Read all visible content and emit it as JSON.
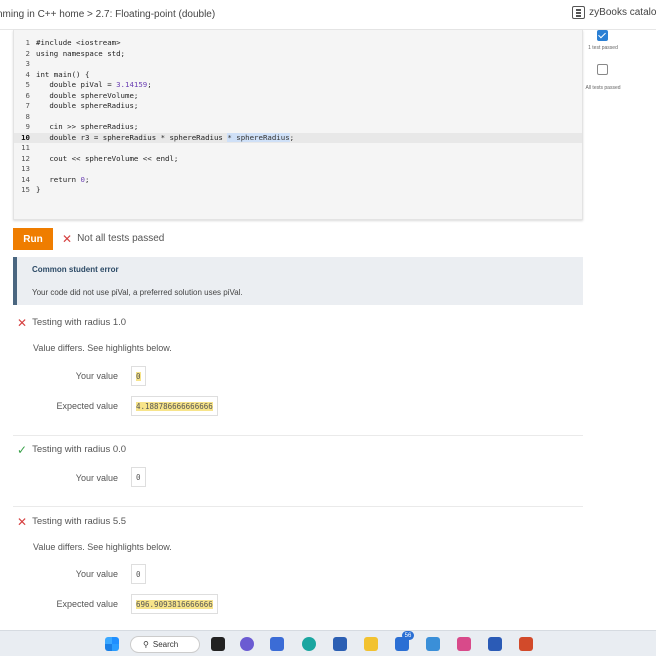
{
  "header": {
    "breadcrumb": "nming in C++ home > 2.7: Floating-point (double)",
    "catalog_label": "zyBooks catalog"
  },
  "editor": {
    "lines": [
      {
        "n": "1",
        "parts": [
          {
            "t": "#include <iostream>",
            "c": "ct"
          }
        ]
      },
      {
        "n": "2",
        "parts": [
          {
            "t": "using namespace std;",
            "c": "ct"
          }
        ]
      },
      {
        "n": "3",
        "parts": [
          {
            "t": "",
            "c": "ct"
          }
        ]
      },
      {
        "n": "4",
        "parts": [
          {
            "t": "int main() {",
            "c": "ct"
          }
        ]
      },
      {
        "n": "5",
        "parts": [
          {
            "t": "   double piVal = ",
            "c": "ct"
          },
          {
            "t": "3.14159",
            "c": "num"
          },
          {
            "t": ";",
            "c": "ct"
          }
        ]
      },
      {
        "n": "6",
        "parts": [
          {
            "t": "   double sphereVolume;",
            "c": "ct"
          }
        ]
      },
      {
        "n": "7",
        "parts": [
          {
            "t": "   double sphereRadius;",
            "c": "ct"
          }
        ]
      },
      {
        "n": "8",
        "parts": [
          {
            "t": "",
            "c": "ct"
          }
        ]
      },
      {
        "n": "9",
        "parts": [
          {
            "t": "   cin >> sphereRadius;",
            "c": "ct"
          }
        ]
      },
      {
        "n": "10",
        "active": true,
        "parts": [
          {
            "t": "   double r3 = sphereRadius * sphereRadius ",
            "c": "ct"
          },
          {
            "t": "* sphereRadius",
            "c": "sel"
          },
          {
            "t": ";",
            "c": "ct"
          }
        ]
      },
      {
        "n": "11",
        "parts": [
          {
            "t": "",
            "c": "ct"
          }
        ]
      },
      {
        "n": "12",
        "parts": [
          {
            "t": "   cout << sphereVolume << endl;",
            "c": "ct"
          }
        ]
      },
      {
        "n": "13",
        "parts": [
          {
            "t": "",
            "c": "ct"
          }
        ]
      },
      {
        "n": "14",
        "parts": [
          {
            "t": "   return ",
            "c": "ct"
          },
          {
            "t": "0",
            "c": "num"
          },
          {
            "t": ";",
            "c": "ct"
          }
        ]
      },
      {
        "n": "15",
        "parts": [
          {
            "t": "}",
            "c": "ct"
          }
        ]
      }
    ]
  },
  "sidebar_status": {
    "test1_label": "1 test passed",
    "all_label": "All tests passed"
  },
  "run": {
    "button_label": "Run",
    "status_text": "Not all tests passed"
  },
  "error": {
    "title": "Common student error",
    "message": "Your code did not use piVal, a preferred solution uses piVal."
  },
  "tests": [
    {
      "title": "Testing with radius 1.0",
      "passed": false,
      "diff_message": "Value differs. See highlights below.",
      "your_label": "Your value",
      "your_value": "0",
      "expected_label": "Expected value",
      "expected_value": "4.188786666666666"
    },
    {
      "title": "Testing with radius 0.0",
      "passed": true,
      "your_label": "Your value",
      "your_value": "0"
    },
    {
      "title": "Testing with radius 5.5",
      "passed": false,
      "diff_message": "Value differs. See highlights below.",
      "your_label": "Your value",
      "your_value": "0",
      "expected_label": "Expected value",
      "expected_value": "696.9093816666666"
    }
  ],
  "taskbar": {
    "search_label": "Search",
    "badge_count": "56"
  },
  "colors": {
    "run_orange": "#ef7d00",
    "error_red": "#d64040",
    "pass_green": "#3aa24a",
    "highlight_yellow": "#f7e48a"
  }
}
